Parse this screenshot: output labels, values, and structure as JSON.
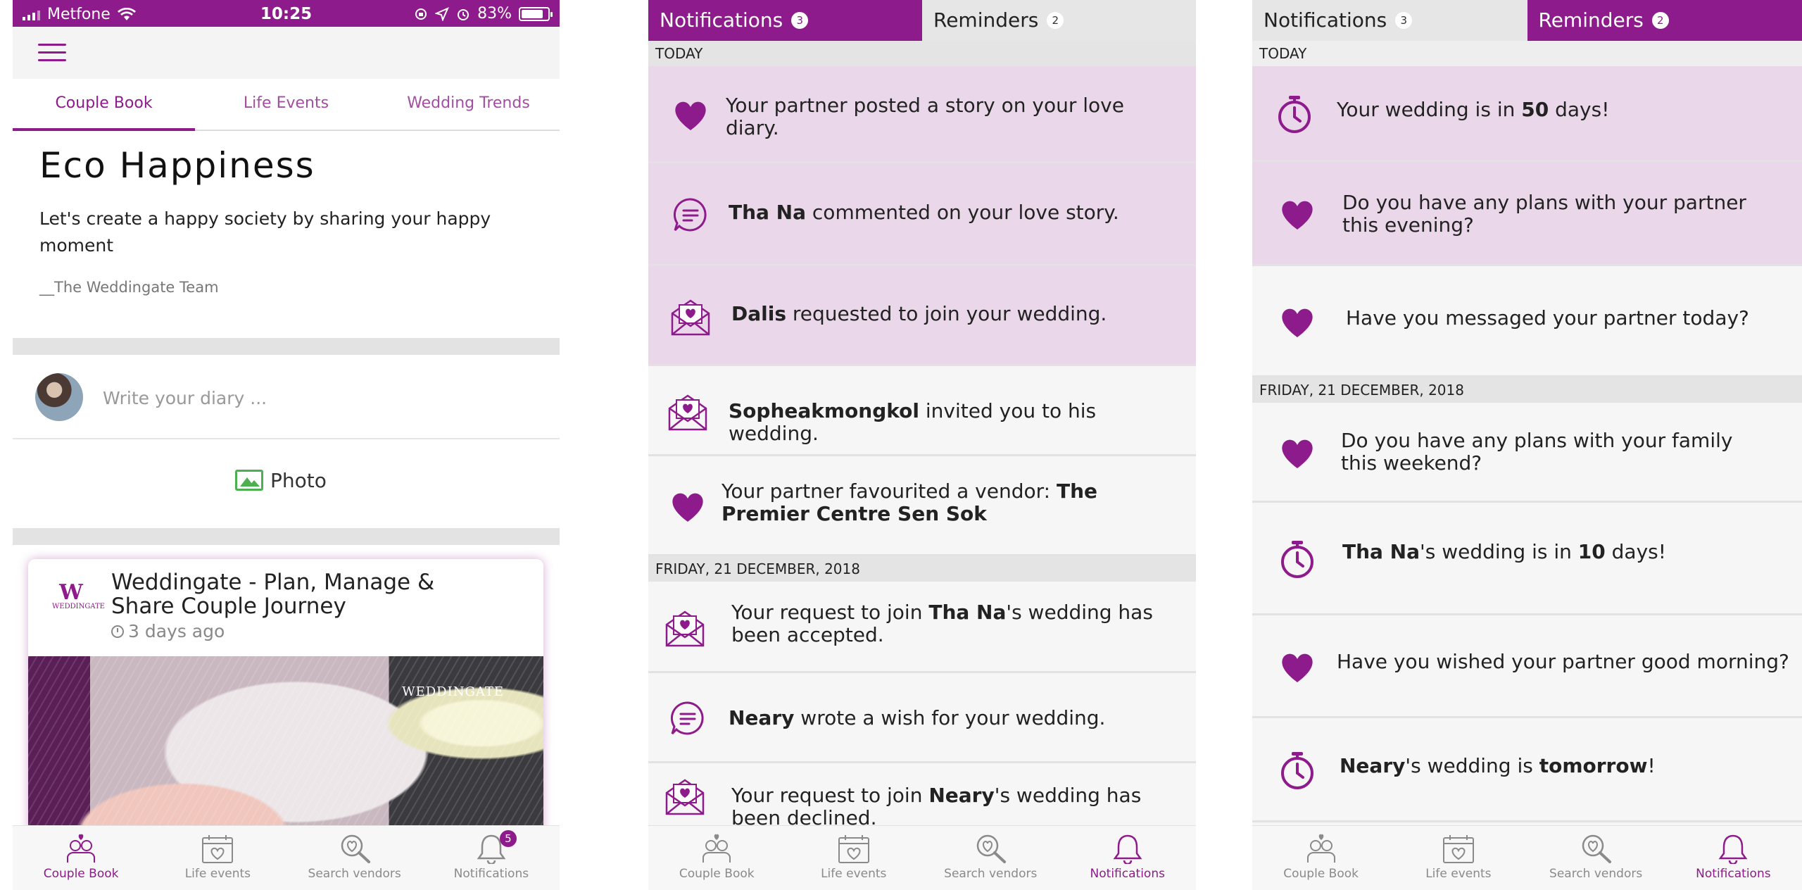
{
  "colors": {
    "brand_purple": "#8e1b8b",
    "unread_bg": "#ead8ea",
    "read_bg": "#f6f6f6",
    "photo_green": "#4caf50"
  },
  "panel1": {
    "status_bar": {
      "carrier": "Metfone",
      "time": "10:25",
      "battery": "83%",
      "battery_level": 0.83
    },
    "tabs": [
      {
        "label": "Couple Book",
        "active": true
      },
      {
        "label": "Life Events",
        "active": false
      },
      {
        "label": "Wedding Trends",
        "active": false
      }
    ],
    "hero": {
      "title": "Eco Happiness",
      "text": "Let's create a happy society by sharing your happy moment",
      "signature": "__The Weddingate Team"
    },
    "composer": {
      "placeholder": "Write your diary ...",
      "photo_label": "Photo"
    },
    "post": {
      "title": "Weddingate - Plan, Manage & Share Couple Journey",
      "time": "3 days ago",
      "logo_text": "WEDDINGATE",
      "watermark": "WEDDINGATE"
    },
    "nav": [
      {
        "label": "Couple Book",
        "icon": "couple-icon",
        "active": true
      },
      {
        "label": "Life events",
        "icon": "calendar-heart-icon",
        "active": false
      },
      {
        "label": "Search vendors",
        "icon": "search-heart-icon",
        "active": false
      },
      {
        "label": "Notifications",
        "icon": "bell-icon",
        "active": false,
        "badge": "5"
      }
    ]
  },
  "panel2": {
    "tabs": [
      {
        "label": "Notifications",
        "count": "3",
        "active": true
      },
      {
        "label": "Reminders",
        "count": "2",
        "active": false
      }
    ],
    "sections": [
      {
        "header": "TODAY"
      },
      {
        "header": "FRIDAY, 21 DECEMBER, 2018"
      }
    ],
    "items": [
      {
        "icon": "heart-icon",
        "html": "Your partner posted a story on <b style='font-weight:normal'>your love</b> diary.",
        "unread": true
      },
      {
        "icon": "comment-icon",
        "bold": "Tha Na",
        "rest": " commented on your love story.",
        "unread": true
      },
      {
        "icon": "envelope-heart-icon",
        "bold": "Dalis",
        "rest": " requested to join your wedding.",
        "unread": true
      },
      {
        "icon": "envelope-heart-icon",
        "bold": "Sopheakmongkol",
        "rest": " invited you to his wedding.",
        "unread": false
      },
      {
        "icon": "heart-icon",
        "pre": "Your partner favourited a vendor: ",
        "bold": "The Premier Centre Sen Sok",
        "unread": false
      },
      {
        "icon": "envelope-heart-icon",
        "pre": "Your request to join ",
        "bold": "Tha Na",
        "rest": "'s wedding has been accepted.",
        "unread": false
      },
      {
        "icon": "comment-icon",
        "bold": "Neary",
        "rest": " wrote a wish for your wedding.",
        "unread": false
      },
      {
        "icon": "envelope-heart-icon",
        "pre": "Your request to join ",
        "bold": "Neary",
        "rest": "'s wedding has been declined.",
        "unread": false
      }
    ],
    "first_item_text": {
      "a": "Your partner posted a story on your love diary."
    },
    "nav": [
      {
        "label": "Couple Book",
        "icon": "couple-icon",
        "active": false
      },
      {
        "label": "Life events",
        "icon": "calendar-heart-icon",
        "active": false
      },
      {
        "label": "Search vendors",
        "icon": "search-heart-icon",
        "active": false
      },
      {
        "label": "Notifications",
        "icon": "bell-icon",
        "active": true
      }
    ]
  },
  "panel3": {
    "tabs": [
      {
        "label": "Notifications",
        "count": "3",
        "active": false
      },
      {
        "label": "Reminders",
        "count": "2",
        "active": true
      }
    ],
    "sections": [
      {
        "header": "TODAY"
      },
      {
        "header": "FRIDAY, 21 DECEMBER, 2018"
      }
    ],
    "items": [
      {
        "icon": "stopwatch-icon",
        "pre": "Your wedding is in ",
        "bold": "50",
        "rest": " days!",
        "unread": true
      },
      {
        "icon": "heart-icon",
        "pre": "Do you have any plans with your partner this evening?",
        "unread": true
      },
      {
        "icon": "heart-icon",
        "pre": "Have you messaged your partner today?",
        "unread": false
      },
      {
        "icon": "heart-icon",
        "pre": "Do you have any plans with your family this weekend?",
        "unread": false
      },
      {
        "icon": "stopwatch-icon",
        "bold": "Tha Na",
        "rest": "'s wedding is in ",
        "bold2": "10",
        "rest2": " days!",
        "unread": false
      },
      {
        "icon": "heart-icon",
        "pre": "Have you wished your partner good morning?",
        "unread": false
      },
      {
        "icon": "stopwatch-icon",
        "bold": "Neary",
        "rest": "'s wedding is ",
        "bold2": "tomorrow",
        "rest2": "!",
        "unread": false
      }
    ],
    "nav": [
      {
        "label": "Couple Book",
        "icon": "couple-icon",
        "active": false
      },
      {
        "label": "Life events",
        "icon": "calendar-heart-icon",
        "active": false
      },
      {
        "label": "Search vendors",
        "icon": "search-heart-icon",
        "active": false
      },
      {
        "label": "Notifications",
        "icon": "bell-icon",
        "active": true
      }
    ]
  }
}
